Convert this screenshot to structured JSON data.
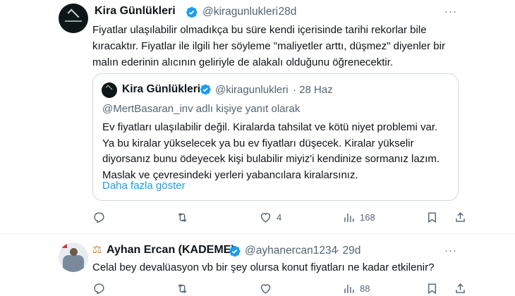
{
  "tweet1": {
    "name": "Kira Günlükleri",
    "handle": "@kiragunlukleri",
    "time": "· 28d",
    "more": "···",
    "text_lines": [
      "Fiyatlar ulaşılabilir olmadıkça bu süre kendi içerisinde tarihi rekorlar bile",
      "kıracaktır. Fiyatlar ile ilgili her söyleme \"maliyetler arttı, düşmez\" diyenler bir",
      "malın ederinin alıcının geliriyle de alakalı olduğunu öğrenecektir."
    ],
    "quote": {
      "name": "Kira Günlükleri",
      "handle": "@kiragunlukleri",
      "time": "· 28 Haz",
      "reply_context": "@MertBasaran_inv adlı kişiye yanıt olarak",
      "text_lines": [
        "Ev fiyatları ulaşılabilir değil. Kiralarda tahsilat ve kötü niyet problemi var.",
        "Ya bu kiralar yükselecek ya bu ev fiyatları düşecek. Kiralar yükselir",
        "diyorsanız bunu ödeyecek kişi bulabilir miyiz'i kendinize sormanız lazım.",
        "Maslak ve çevresindeki yerleri yabancılara kiralarsınız."
      ],
      "show_more": "Daha fazla göster"
    },
    "actions": {
      "reply_count": "",
      "retweet_count": "",
      "like_count": "4",
      "views_count": "168"
    }
  },
  "tweet2": {
    "name_prefix_icon": "scales-icon",
    "name": "Ayhan Ercan (KADEME)",
    "handle": "@ayhanercan1234",
    "time": "· 29d",
    "more": "···",
    "text": "Celal bey devalüasyon vb bir şey olursa konut fiyatları ne kadar etkilenir?",
    "actions": {
      "reply_count": "",
      "retweet_count": "",
      "like_count": "",
      "views_count": "88"
    }
  },
  "colors": {
    "verified": "#1d9bf0",
    "link": "#1d9bf0",
    "secondary_text": "#536471",
    "border": "#cfd9de"
  }
}
